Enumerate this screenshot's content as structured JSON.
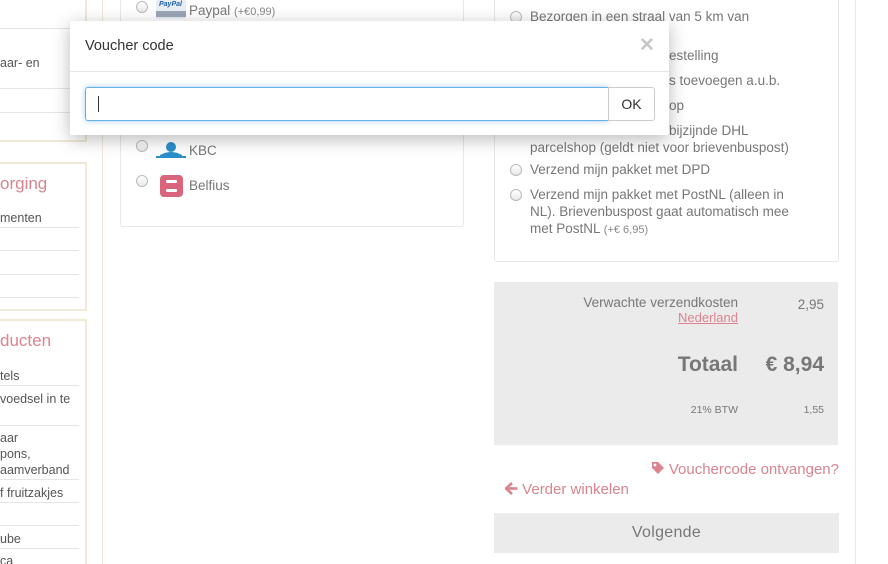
{
  "sidebar": {
    "top_items": [
      "aar- en"
    ],
    "mid_heading": "orging",
    "mid_items": [
      "menten"
    ],
    "bottom_heading": "ducten",
    "bottom_items": [
      "tels",
      "voedsel in te",
      "aar",
      "pons,",
      "aamverband",
      "f fruitzakjes",
      "ube",
      "ca"
    ]
  },
  "payment": {
    "paypal_label": "Paypal",
    "paypal_fee": "(+€0,99)",
    "paypal_logo_text": "PayPal",
    "kbc_label": "KBC",
    "belfius_label": "Belfius"
  },
  "shipping": {
    "opt_radius": "Bezorgen in een straal van 5 km van",
    "frag_bestelling": "estelling",
    "frag_toevoegen": "s toevoegen a.u.b.",
    "frag_op": "op",
    "opt_dhl_1": "bijzijnde DHL",
    "opt_dhl_2": "parcelshop (geldt niet voor brievenbuspost)",
    "opt_dpd": "Verzend mijn pakket met DPD",
    "opt_postnl_1": "Verzend mijn pakket met PostNL (alleen in",
    "opt_postnl_2": "NL). Brievenbuspost gaat automatisch mee",
    "opt_postnl_3": "met PostNL",
    "opt_postnl_fee": "(+€ 6,95)"
  },
  "totals": {
    "shipping_label": "Verwachte verzendkosten",
    "country_link": "Nederland",
    "shipping_value": "2,95",
    "total_label": "Totaal",
    "total_value": "€ 8,94",
    "vat_label": "21% BTW",
    "vat_value": "1,55"
  },
  "actions": {
    "voucher_link": "Vouchercode ontvangen?",
    "continue_link": "Verder winkelen",
    "next_button": "Volgende"
  },
  "modal": {
    "title": "Voucher code",
    "input_value": "",
    "ok_label": "OK"
  },
  "colors": {
    "accent_pink": "#d9848f",
    "focus_blue": "#66afe9",
    "panel_gray": "#ebebeb"
  }
}
